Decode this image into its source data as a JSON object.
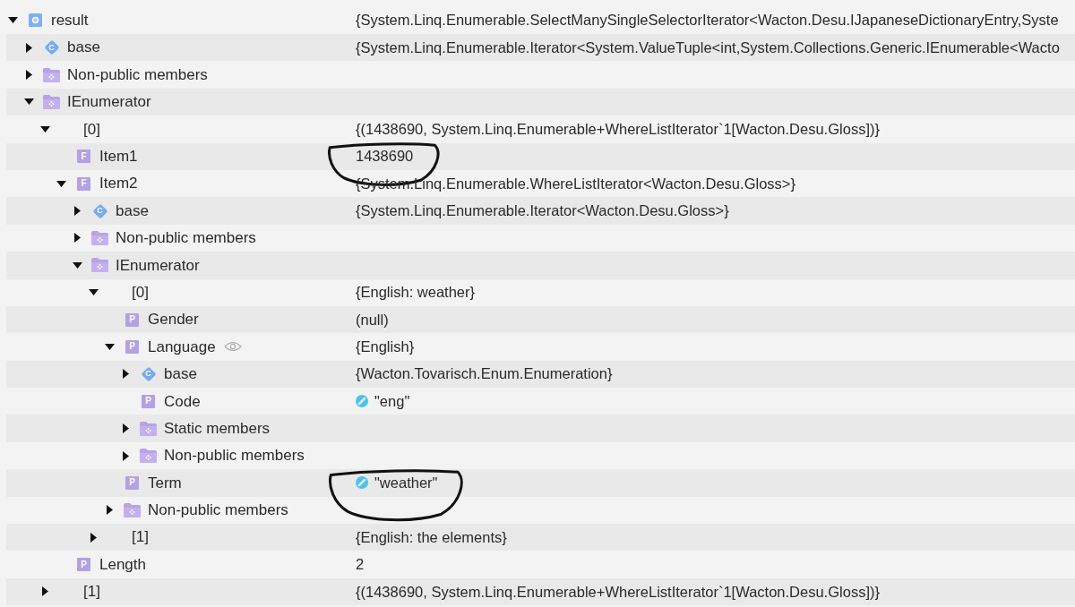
{
  "tree": [
    {
      "label": "result",
      "kind": "object",
      "value": "{System.Linq.Enumerable.SelectManySingleSelectorIterator<Wacton.Desu.IJapaneseDictionaryEntry,Syste",
      "expanded": true,
      "children": [
        {
          "label": "base",
          "kind": "class",
          "badge": "C",
          "value": "{System.Linq.Enumerable.Iterator<System.ValueTuple<int,System.Collections.Generic.IEnumerable<Wacto",
          "expanded": false
        },
        {
          "label": "Non-public members",
          "kind": "group",
          "expanded": false
        },
        {
          "label": "IEnumerator",
          "kind": "group",
          "expanded": true,
          "children": [
            {
              "label": "[0]",
              "value": "{(1438690, System.Linq.Enumerable+WhereListIterator`1[Wacton.Desu.Gloss])}",
              "expanded": true,
              "children": [
                {
                  "label": "Item1",
                  "kind": "member",
                  "badge": "F",
                  "value": "1438690",
                  "circled": true
                },
                {
                  "label": "Item2",
                  "kind": "member",
                  "badge": "F",
                  "value": "{System.Linq.Enumerable.WhereListIterator<Wacton.Desu.Gloss>}",
                  "expanded": true,
                  "children": [
                    {
                      "label": "base",
                      "kind": "class",
                      "badge": "C",
                      "value": "{System.Linq.Enumerable.Iterator<Wacton.Desu.Gloss>}",
                      "expanded": false
                    },
                    {
                      "label": "Non-public members",
                      "kind": "group",
                      "expanded": false
                    },
                    {
                      "label": "IEnumerator",
                      "kind": "group",
                      "expanded": true,
                      "children": [
                        {
                          "label": "[0]",
                          "value": "{English: weather}",
                          "expanded": true,
                          "children": [
                            {
                              "label": "Gender",
                              "kind": "member",
                              "badge": "P",
                              "value": "(null)"
                            },
                            {
                              "label": "Language",
                              "kind": "member",
                              "badge": "P",
                              "value": "{English}",
                              "expanded": true,
                              "preview": true,
                              "children": [
                                {
                                  "label": "base",
                                  "kind": "class",
                                  "badge": "C",
                                  "value": "{Wacton.Tovarisch.Enum.Enumeration}",
                                  "expanded": false
                                },
                                {
                                  "label": "Code",
                                  "kind": "member",
                                  "badge": "P",
                                  "value": "\"eng\"",
                                  "string_value": true
                                },
                                {
                                  "label": "Static members",
                                  "kind": "group",
                                  "expanded": false
                                },
                                {
                                  "label": "Non-public members",
                                  "kind": "group",
                                  "expanded": false
                                }
                              ]
                            },
                            {
                              "label": "Term",
                              "kind": "member",
                              "badge": "P",
                              "value": "\"weather\"",
                              "string_value": true,
                              "circled": true
                            },
                            {
                              "label": "Non-public members",
                              "kind": "group",
                              "expanded": false
                            }
                          ]
                        },
                        {
                          "label": "[1]",
                          "value": "{English: the elements}",
                          "expanded": false
                        }
                      ]
                    }
                  ]
                },
                {
                  "label": "Length",
                  "kind": "member",
                  "badge": "P",
                  "value": "2"
                }
              ]
            },
            {
              "label": "[1]",
              "value": "{(1438690, System.Linq.Enumerable+WhereListIterator`1[Wacton.Desu.Gloss])}",
              "expanded": false
            }
          ]
        }
      ]
    }
  ]
}
